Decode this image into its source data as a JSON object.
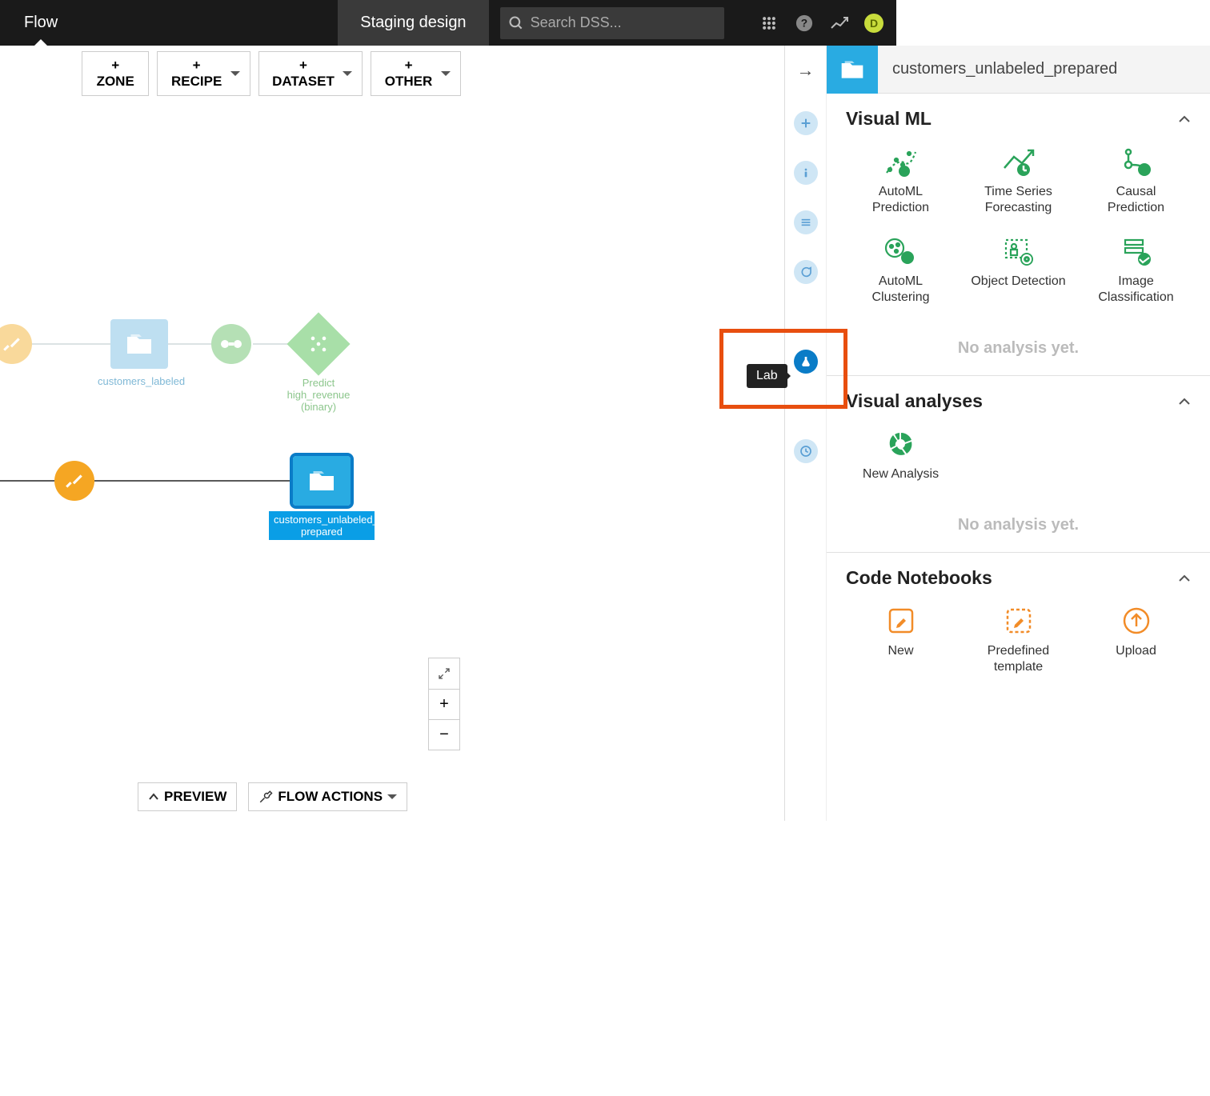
{
  "topbar": {
    "flow_tab": "Flow",
    "staging_label": "Staging design",
    "search_placeholder": "Search DSS...",
    "avatar_letter": "D"
  },
  "toolbar": {
    "zone": "+ ZONE",
    "recipe": "+ RECIPE",
    "dataset": "+ DATASET",
    "other": "+ OTHER"
  },
  "flow": {
    "customers_labeled": "customers_labeled",
    "predict_label_l1": "Predict high_revenue",
    "predict_label_l2": "(binary)",
    "selected_label_l1": "customers_unlabeled_",
    "selected_label_l2": "prepared"
  },
  "rail": {
    "tooltip": "Lab"
  },
  "panel": {
    "dataset_name": "customers_unlabeled_prepared",
    "sections": {
      "visual_ml": {
        "title": "Visual ML",
        "tiles": [
          {
            "label": "AutoML Prediction"
          },
          {
            "label": "Time Series Forecasting"
          },
          {
            "label": "Causal Prediction"
          },
          {
            "label": "AutoML Clustering"
          },
          {
            "label": "Object Detection"
          },
          {
            "label": "Image Classification"
          }
        ],
        "empty": "No analysis yet."
      },
      "visual_analyses": {
        "title": "Visual analyses",
        "tiles": [
          {
            "label": "New Analysis"
          }
        ],
        "empty": "No analysis yet."
      },
      "code_notebooks": {
        "title": "Code Notebooks",
        "tiles": [
          {
            "label": "New"
          },
          {
            "label": "Predefined template"
          },
          {
            "label": "Upload"
          }
        ]
      }
    }
  },
  "bottom": {
    "preview": "PREVIEW",
    "flow_actions": "FLOW ACTIONS"
  }
}
